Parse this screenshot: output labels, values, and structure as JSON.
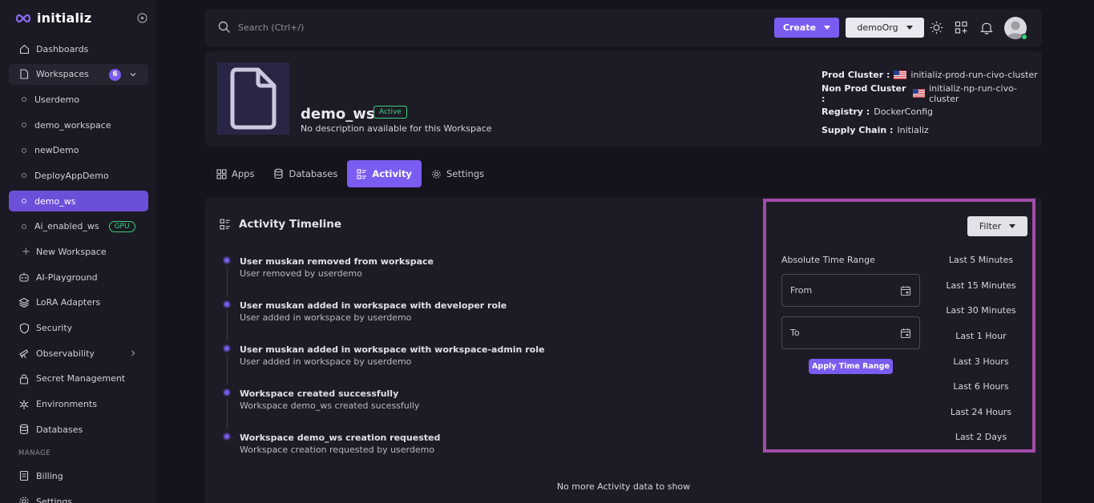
{
  "brand": {
    "name": "initializ",
    "accent": "#7b5cf0"
  },
  "sidebar": {
    "dashboards": "Dashboards",
    "workspaces": "Workspaces",
    "workspaces_count": "6",
    "workspace_items": [
      "Userdemo",
      "demo_workspace",
      "newDemo",
      "DeployAppDemo",
      "demo_ws",
      "Ai_enabled_ws"
    ],
    "gpu_badge": "GPU",
    "new_workspace": "New Workspace",
    "ai_playground": "AI-Playground",
    "lora": "LoRA Adapters",
    "security": "Security",
    "observability": "Observability",
    "secret_management": "Secret Management",
    "environments": "Environments",
    "databases": "Databases",
    "manage_label": "MANAGE",
    "billing": "Billing",
    "settings": "Settings"
  },
  "topbar": {
    "search_placeholder": "Search (Ctrl+/)",
    "create_label": "Create",
    "org_label": "demoOrg"
  },
  "workspace": {
    "name": "demo_ws",
    "status": "Active",
    "description": "No description available for this Workspace",
    "prod_cluster_label": "Prod Cluster :",
    "prod_cluster": "initializ-prod-run-civo-cluster",
    "nonprod_cluster_label": "Non Prod Cluster :",
    "nonprod_cluster": "initializ-np-run-civo-cluster",
    "registry_label": "Registry :",
    "registry": "DockerConfig",
    "supply_chain_label": "Supply Chain :",
    "supply_chain": "Initializ"
  },
  "tabs": [
    "Apps",
    "Databases",
    "Activity",
    "Settings"
  ],
  "activity": {
    "title": "Activity Timeline",
    "items": [
      {
        "title": "User muskan removed from workspace",
        "sub": "User removed by userdemo"
      },
      {
        "title": "User muskan added in workspace with developer role",
        "sub": "User added in workspace by userdemo"
      },
      {
        "title": "User muskan added in workspace with workspace-admin role",
        "sub": "User added in workspace by userdemo"
      },
      {
        "title": "Workspace created successfully",
        "sub": "Workspace demo_ws created sucessfully"
      },
      {
        "title": "Workspace demo_ws creation requested",
        "sub": "Workspace creation requested by userdemo"
      }
    ],
    "no_more": "No more Activity data to show"
  },
  "filter": {
    "button": "Filter",
    "absolute_label": "Absolute Time Range",
    "from": "From",
    "to": "To",
    "apply": "Apply Time Range",
    "ranges": [
      "Last 5 Minutes",
      "Last 15 Minutes",
      "Last 30 Minutes",
      "Last 1 Hour",
      "Last 3 Hours",
      "Last 6 Hours",
      "Last 24 Hours",
      "Last 2 Days"
    ]
  }
}
